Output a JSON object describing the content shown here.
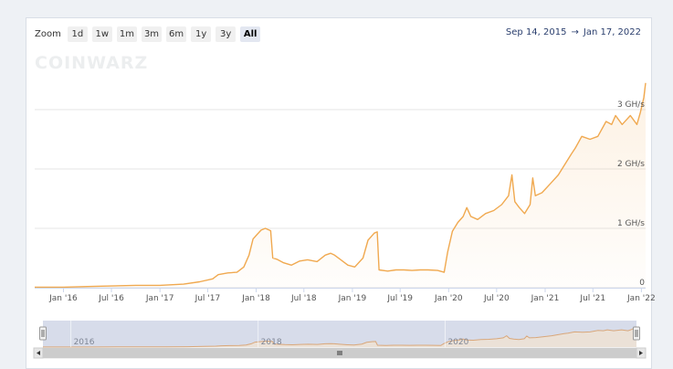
{
  "zoom": {
    "label": "Zoom",
    "buttons": [
      "1d",
      "1w",
      "1m",
      "3m",
      "6m",
      "1y",
      "3y",
      "All"
    ],
    "active": "All"
  },
  "date_range": {
    "from": "Sep 14, 2015",
    "arrow": "→",
    "to": "Jan 17, 2022"
  },
  "watermark": "COINWARZ",
  "colors": {
    "line": "#f0a950",
    "navigator_mask": "#d3d8e8",
    "grid": "#e6e6e6"
  },
  "chart_data": {
    "type": "area",
    "title": "",
    "xlabel": "",
    "ylabel": "",
    "y_unit": "GH/s",
    "ylim": [
      0,
      3.5
    ],
    "xlim": [
      "2015-09-14",
      "2022-01-17"
    ],
    "grid": true,
    "y_ticks": [
      {
        "value": 0,
        "label": "0"
      },
      {
        "value": 1,
        "label": "1 GH/s"
      },
      {
        "value": 2,
        "label": "2 GH/s"
      },
      {
        "value": 3,
        "label": "3 GH/s"
      }
    ],
    "x_ticks": [
      {
        "date": "2016-01-01",
        "label": "Jan '16"
      },
      {
        "date": "2016-07-01",
        "label": "Jul '16"
      },
      {
        "date": "2017-01-01",
        "label": "Jan '17"
      },
      {
        "date": "2017-07-01",
        "label": "Jul '17"
      },
      {
        "date": "2018-01-01",
        "label": "Jan '18"
      },
      {
        "date": "2018-07-01",
        "label": "Jul '18"
      },
      {
        "date": "2019-01-01",
        "label": "Jan '19"
      },
      {
        "date": "2019-07-01",
        "label": "Jul '19"
      },
      {
        "date": "2020-01-01",
        "label": "Jan '20"
      },
      {
        "date": "2020-07-01",
        "label": "Jul '20"
      },
      {
        "date": "2021-01-01",
        "label": "Jan '21"
      },
      {
        "date": "2021-07-01",
        "label": "Jul '21"
      },
      {
        "date": "2022-01-01",
        "label": "Jan '22"
      }
    ],
    "navigator_labels": [
      {
        "date": "2016-01-01",
        "label": "2016"
      },
      {
        "date": "2018-01-01",
        "label": "2018"
      },
      {
        "date": "2020-01-01",
        "label": "2020"
      }
    ],
    "series": [
      {
        "points": [
          [
            "2015-09-14",
            0.01
          ],
          [
            "2016-01-01",
            0.01
          ],
          [
            "2016-04-01",
            0.02
          ],
          [
            "2016-07-01",
            0.03
          ],
          [
            "2016-10-01",
            0.04
          ],
          [
            "2017-01-01",
            0.04
          ],
          [
            "2017-04-01",
            0.06
          ],
          [
            "2017-06-01",
            0.1
          ],
          [
            "2017-07-20",
            0.15
          ],
          [
            "2017-08-10",
            0.22
          ],
          [
            "2017-09-15",
            0.25
          ],
          [
            "2017-10-20",
            0.26
          ],
          [
            "2017-11-15",
            0.35
          ],
          [
            "2017-12-05",
            0.55
          ],
          [
            "2017-12-20",
            0.82
          ],
          [
            "2018-01-05",
            0.9
          ],
          [
            "2018-01-20",
            0.97
          ],
          [
            "2018-02-05",
            1.0
          ],
          [
            "2018-02-25",
            0.96
          ],
          [
            "2018-03-05",
            0.5
          ],
          [
            "2018-03-20",
            0.48
          ],
          [
            "2018-04-15",
            0.42
          ],
          [
            "2018-05-15",
            0.38
          ],
          [
            "2018-06-15",
            0.45
          ],
          [
            "2018-07-15",
            0.47
          ],
          [
            "2018-08-20",
            0.44
          ],
          [
            "2018-09-20",
            0.55
          ],
          [
            "2018-10-10",
            0.58
          ],
          [
            "2018-10-25",
            0.55
          ],
          [
            "2018-11-15",
            0.48
          ],
          [
            "2018-12-15",
            0.38
          ],
          [
            "2019-01-10",
            0.35
          ],
          [
            "2019-02-10",
            0.5
          ],
          [
            "2019-03-01",
            0.8
          ],
          [
            "2019-03-25",
            0.92
          ],
          [
            "2019-04-05",
            0.94
          ],
          [
            "2019-04-12",
            0.3
          ],
          [
            "2019-05-15",
            0.28
          ],
          [
            "2019-06-15",
            0.3
          ],
          [
            "2019-07-15",
            0.3
          ],
          [
            "2019-08-15",
            0.29
          ],
          [
            "2019-09-15",
            0.3
          ],
          [
            "2019-10-15",
            0.3
          ],
          [
            "2019-11-20",
            0.29
          ],
          [
            "2019-12-15",
            0.26
          ],
          [
            "2019-12-28",
            0.6
          ],
          [
            "2020-01-15",
            0.95
          ],
          [
            "2020-02-05",
            1.1
          ],
          [
            "2020-02-25",
            1.2
          ],
          [
            "2020-03-10",
            1.35
          ],
          [
            "2020-03-25",
            1.2
          ],
          [
            "2020-04-20",
            1.15
          ],
          [
            "2020-05-20",
            1.25
          ],
          [
            "2020-06-20",
            1.3
          ],
          [
            "2020-07-20",
            1.4
          ],
          [
            "2020-08-15",
            1.55
          ],
          [
            "2020-08-28",
            1.9
          ],
          [
            "2020-09-08",
            1.45
          ],
          [
            "2020-09-25",
            1.35
          ],
          [
            "2020-10-15",
            1.25
          ],
          [
            "2020-11-05",
            1.4
          ],
          [
            "2020-11-15",
            1.85
          ],
          [
            "2020-11-25",
            1.55
          ],
          [
            "2020-12-20",
            1.6
          ],
          [
            "2021-01-20",
            1.75
          ],
          [
            "2021-02-20",
            1.9
          ],
          [
            "2021-03-20",
            2.1
          ],
          [
            "2021-04-10",
            2.25
          ],
          [
            "2021-04-25",
            2.35
          ],
          [
            "2021-05-20",
            2.55
          ],
          [
            "2021-06-20",
            2.5
          ],
          [
            "2021-07-20",
            2.55
          ],
          [
            "2021-08-20",
            2.8
          ],
          [
            "2021-09-10",
            2.75
          ],
          [
            "2021-09-25",
            2.9
          ],
          [
            "2021-10-20",
            2.75
          ],
          [
            "2021-11-20",
            2.9
          ],
          [
            "2021-12-15",
            2.75
          ],
          [
            "2021-12-28",
            2.95
          ],
          [
            "2022-01-10",
            3.2
          ],
          [
            "2022-01-17",
            3.45
          ]
        ]
      }
    ]
  }
}
